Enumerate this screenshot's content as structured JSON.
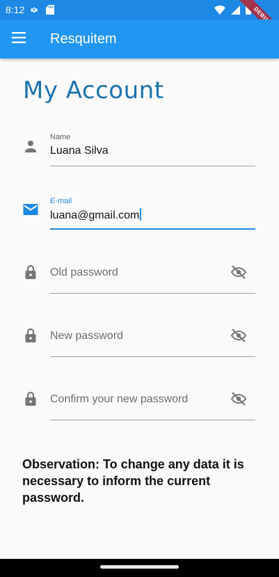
{
  "status_bar": {
    "time": "8:12",
    "icons_left": [
      "settings-icon",
      "sd-card-icon"
    ],
    "icons_right": [
      "wifi-icon",
      "signal-icon",
      "battery-icon"
    ],
    "debug_label": "DEBUG"
  },
  "app_bar": {
    "title": "Resquitem",
    "menu_icon": "menu-icon"
  },
  "page": {
    "title": "My Account"
  },
  "fields": {
    "name": {
      "label": "Name",
      "value": "Luana Silva",
      "icon": "person-icon"
    },
    "email": {
      "label": "E-mail",
      "value": "luana@gmail.com",
      "icon": "email-icon",
      "focused": true
    },
    "old_password": {
      "placeholder": "Old password",
      "icon": "lock-icon",
      "toggle_icon": "visibility-off-icon"
    },
    "new_password": {
      "placeholder": "New password",
      "icon": "lock-icon",
      "toggle_icon": "visibility-off-icon"
    },
    "confirm_password": {
      "placeholder": "Confirm your new password",
      "icon": "lock-icon",
      "toggle_icon": "visibility-off-icon"
    }
  },
  "observation": "Observation: To change any data it is necessary to inform the current password.",
  "colors": {
    "app_bar": "#2196f3",
    "status_bar": "#1e88e5",
    "title": "#1a73ad",
    "focus": "#1e88e5",
    "icon": "#757575",
    "debug_banner": "#a3344b"
  }
}
